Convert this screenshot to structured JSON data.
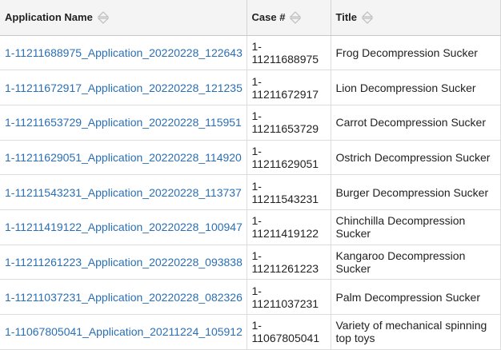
{
  "table": {
    "headers": {
      "application_name": "Application Name",
      "case_number": "Case #",
      "title": "Title"
    },
    "rows": [
      {
        "application": "1-11211688975_Application_20220228_122643",
        "case_line1": "1-",
        "case_line2": "11211688975",
        "title": "Frog Decompression Sucker"
      },
      {
        "application": "1-11211672917_Application_20220228_121235",
        "case_line1": "1-",
        "case_line2": "11211672917",
        "title": "Lion Decompression Sucker"
      },
      {
        "application": "1-11211653729_Application_20220228_115951",
        "case_line1": "1-",
        "case_line2": "11211653729",
        "title": "Carrot Decompression Sucker"
      },
      {
        "application": "1-11211629051_Application_20220228_114920",
        "case_line1": "1-",
        "case_line2": "11211629051",
        "title": "Ostrich Decompression Sucker"
      },
      {
        "application": "1-11211543231_Application_20220228_113737",
        "case_line1": "1-",
        "case_line2": "11211543231",
        "title": "Burger Decompression Sucker"
      },
      {
        "application": "1-11211419122_Application_20220228_100947",
        "case_line1": "1-",
        "case_line2": "11211419122",
        "title": "Chinchilla Decompression Sucker"
      },
      {
        "application": "1-11211261223_Application_20220228_093838",
        "case_line1": "1-",
        "case_line2": "11211261223",
        "title": "Kangaroo Decompression Sucker"
      },
      {
        "application": "1-11211037231_Application_20220228_082326",
        "case_line1": "1-",
        "case_line2": "11211037231",
        "title": "Palm Decompression Sucker"
      },
      {
        "application": "1-11067805041_Application_20211224_105912",
        "case_line1": "1-",
        "case_line2": "11067805041",
        "title": "Variety of mechanical spinning top toys"
      }
    ]
  },
  "icons": {
    "sort": "sort-icon"
  },
  "colors": {
    "link": "#2a6fb5",
    "header_bg": "#f4f4f4"
  }
}
